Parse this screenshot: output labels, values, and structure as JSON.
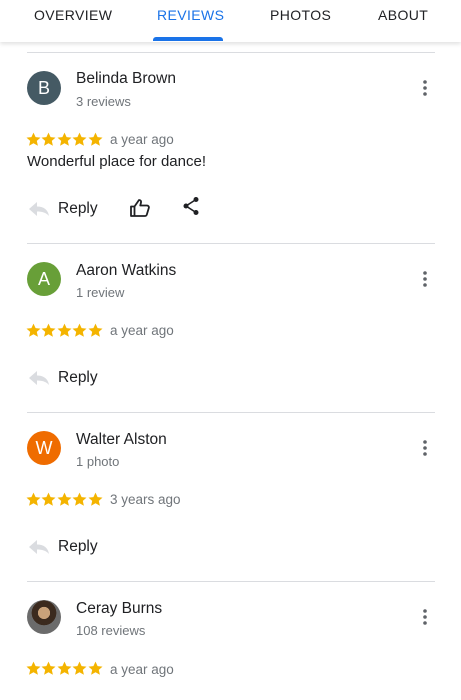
{
  "tabs": [
    {
      "label": "OVERVIEW"
    },
    {
      "label": "REVIEWS"
    },
    {
      "label": "PHOTOS"
    },
    {
      "label": "ABOUT"
    }
  ],
  "active_tab": "REVIEWS",
  "colors": {
    "accent": "#1a73e8",
    "star": "#f4b400"
  },
  "reviews": [
    {
      "initial": "B",
      "avatar_color": "#455a64",
      "name": "Belinda Brown",
      "meta": "3 reviews",
      "rating": 5,
      "time": "a year ago",
      "text": "Wonderful place for dance!",
      "reply_label": "Reply"
    },
    {
      "initial": "A",
      "avatar_color": "#689f38",
      "name": "Aaron Watkins",
      "meta": "1 review",
      "rating": 5,
      "time": "a year ago",
      "text": "",
      "reply_label": "Reply"
    },
    {
      "initial": "W",
      "avatar_color": "#ef6c00",
      "name": "Walter Alston",
      "meta": "1 photo",
      "rating": 5,
      "time": "3 years ago",
      "text": "",
      "reply_label": "Reply"
    },
    {
      "initial": "",
      "avatar_color": "",
      "name": "Ceray Burns",
      "meta": "108 reviews",
      "rating": 5,
      "time": "a year ago",
      "text": "",
      "reply_label": ""
    }
  ]
}
